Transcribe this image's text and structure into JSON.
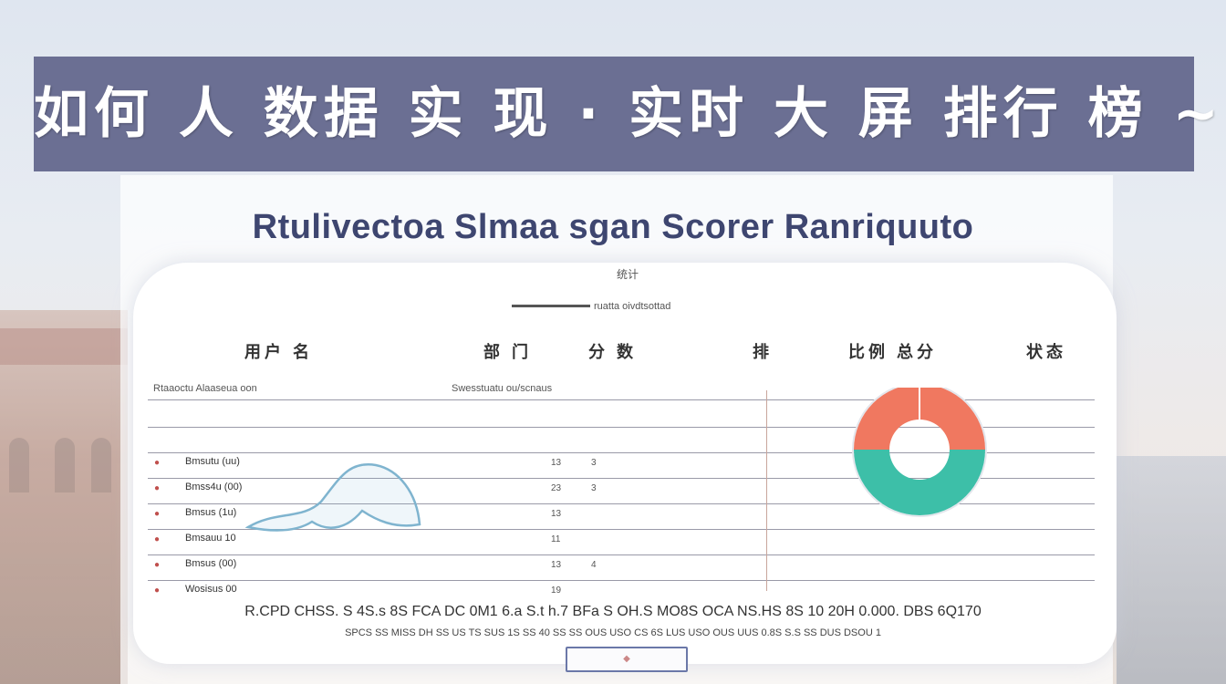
{
  "banner": {
    "title": "如何 人 数据 实 现 · 实时 大 屏 排行 榜 ~"
  },
  "subtitle": "Rtulivectoa Slmaa sgan Scorer Ranriquuto",
  "caption_small": "统计",
  "legend_caption": "ruatta oivdtsottad",
  "headers": [
    "用户 名",
    "部 门",
    "分 数",
    "排",
    "比例 总分",
    "状态"
  ],
  "table_caption_left": "Rtaaoctu Alaaseua oon",
  "table_caption_mid": "Swesstuatu ou/scnaus",
  "rows": [
    {
      "label": "Bmsutu (uu)",
      "a": "13",
      "b": "3"
    },
    {
      "label": "Bmss4u (00)",
      "a": "23",
      "b": "3"
    },
    {
      "label": "Bmsus (1u)",
      "a": "13",
      "b": ""
    },
    {
      "label": "Bmsauu 10",
      "a": "11",
      "b": ""
    },
    {
      "label": "Bmsus (00)",
      "a": "13",
      "b": "4"
    },
    {
      "label": "Wosisus 00",
      "a": "19",
      "b": ""
    }
  ],
  "footer_line1": "R.CPD CHSS. S 4S.s 8S FCA DC 0M1 6.a S.t h.7 BFa S OH.S MO8S OCA NS.HS 8S 10 20H 0.000. DBS 6Q170",
  "footer_line2": "SPCS SS MISS DH SS US TS SUS 1S SS 40 SS SS OUS USO CS 6S LUS USO OUS UUS 0.8S S.S SS DUS DSOU 1",
  "colors": {
    "banner": "#6b6f93",
    "donut_orange": "#f07860",
    "donut_teal": "#3dbfa8",
    "subtitle": "#3e4670"
  },
  "donut": {
    "orange_fraction": 0.5,
    "teal_fraction": 0.5
  }
}
